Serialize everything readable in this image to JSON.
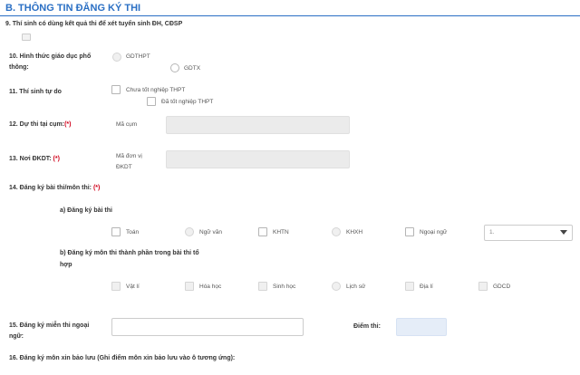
{
  "section": {
    "title": "B. THÔNG TIN ĐĂNG KÝ THI"
  },
  "q9": {
    "label": "9. Thí sinh có dùng kết quả thi để xét tuyển sinh ĐH, CĐSP"
  },
  "q10": {
    "label_line1": "10. Hình thức giáo dục phổ",
    "label_line2": "thông:",
    "option1": "GDTHPT",
    "option2": "GDTX"
  },
  "q11": {
    "label": "11. Thí sinh tự do",
    "option1": "Chưa tốt nghiệp THPT",
    "option2": "Đã tốt nghiệp THPT"
  },
  "q12": {
    "label": "12. Dự thi tại cụm:",
    "required": "(*)",
    "field_label": "Mã cụm"
  },
  "q13": {
    "label": "13. Nơi ĐKDT:",
    "required": "(*)",
    "field_label_line1": "Mã đơn vị",
    "field_label_line2": "ĐKDT"
  },
  "q14": {
    "label": "14. Đăng ký bài thi/môn thi:",
    "required": "(*)",
    "sub_a": "a) Đăng ký bài thi",
    "exams": [
      "Toán",
      "Ngữ văn",
      "KHTN",
      "KHXH",
      "Ngoại ngữ"
    ],
    "language_select_value": "1.",
    "sub_b_line1": "b) Đăng ký môn thi thành phần trong bài thi tổ",
    "sub_b_line2": "hợp",
    "subjects": [
      "Vật lí",
      "Hóa học",
      "Sinh học",
      "Lịch sử",
      "Địa lí",
      "GDCD"
    ]
  },
  "q15": {
    "label_line1": "15. Đăng ký miễn thi ngoại",
    "label_line2": "ngữ:",
    "score_label": "Điểm thi:"
  },
  "q16": {
    "label": "16. Đăng ký môn xin bảo lưu (Ghi điểm môn xin bảo lưu vào ô tương ứng):"
  },
  "colors": {
    "accent": "#2a6fc4",
    "required": "#d0021b"
  }
}
